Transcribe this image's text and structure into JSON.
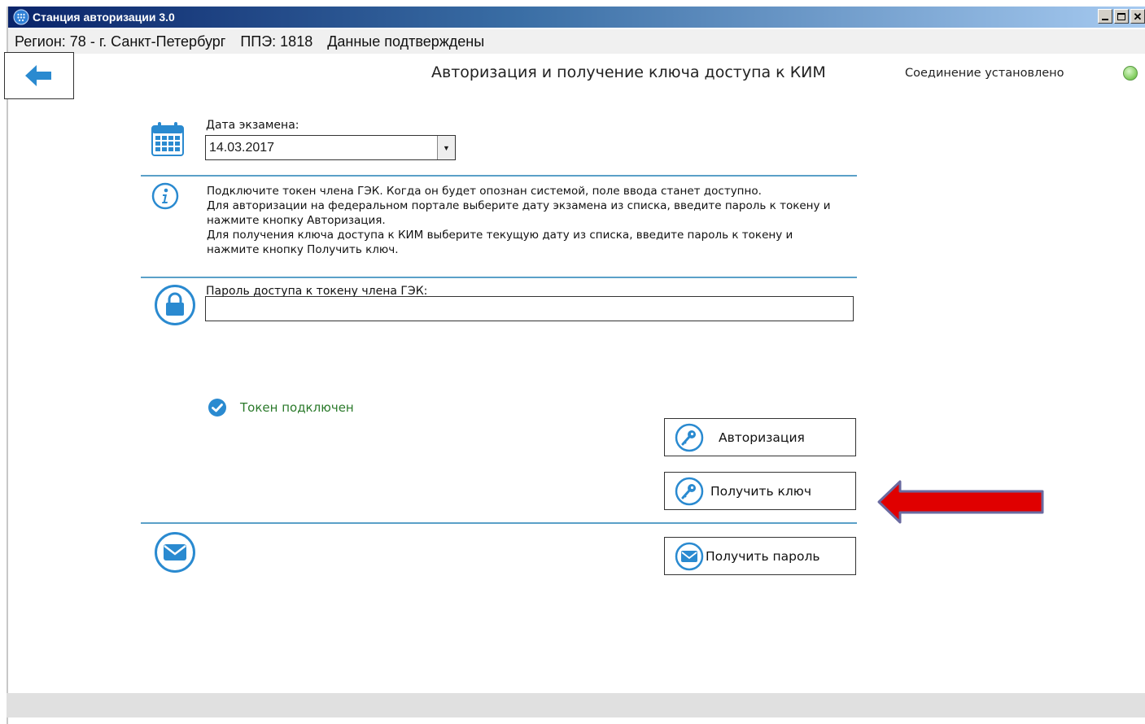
{
  "window": {
    "title": "Станция авторизации 3.0",
    "controls": [
      "minimize",
      "maximize",
      "close"
    ]
  },
  "status_bar": {
    "region": "Регион: 78 - г. Санкт-Петербург",
    "ppe": "ППЭ: 1818",
    "data_status": "Данные подтверждены"
  },
  "header": {
    "title": "Авторизация и получение ключа доступа к КИМ",
    "connection_text": "Соединение установлено",
    "connection_color": "#7ecb5a"
  },
  "exam_date": {
    "label": "Дата экзамена:",
    "value": "14.03.2017"
  },
  "info": {
    "lines": [
      "Подключите токен члена ГЭК. Когда он будет опознан системой, поле ввода станет доступно.",
      "Для авторизации на федеральном портале выберите дату экзамена из списка, введите пароль к токену и",
      "нажмите кнопку Авторизация.",
      "Для получения ключа доступа к КИМ выберите текущую дату из списка, введите пароль к токену и",
      "нажмите кнопку Получить ключ."
    ]
  },
  "password": {
    "label": "Пароль доступа к токену члена ГЭК:",
    "value": ""
  },
  "token": {
    "status": "Токен подключен",
    "color": "#2b7a2b"
  },
  "buttons": {
    "authorize": "Авторизация",
    "get_key": "Получить ключ",
    "get_password": "Получить пароль"
  },
  "colors": {
    "accent": "#2a8ad0",
    "divider": "#5aa0c8",
    "annotation_arrow": "#e00000"
  }
}
